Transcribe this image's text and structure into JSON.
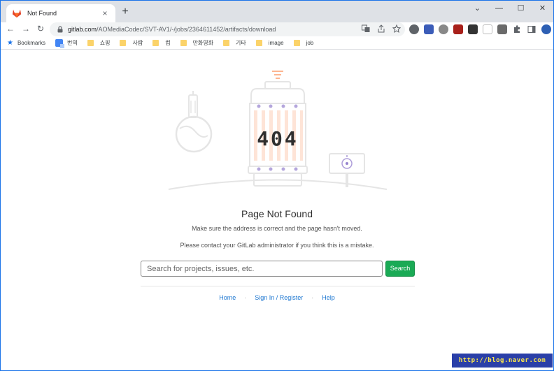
{
  "browser": {
    "tab": {
      "title": "Not Found",
      "close_glyph": "×"
    },
    "new_tab_glyph": "+",
    "window_controls": {
      "chevron": "⌄",
      "minimize": "—",
      "maximize": "☐",
      "close": "✕"
    },
    "nav": {
      "back": "←",
      "forward": "→",
      "reload": "↻"
    },
    "url": {
      "host": "gitlab.com",
      "path": "/AOMediaCodec/SVT-AV1/-/jobs/2364611452/artifacts/download"
    },
    "menu_glyph": "⋮",
    "bookmarks": [
      {
        "label": "Bookmarks",
        "icon": "star-icon"
      },
      {
        "label": "번역",
        "icon": "translate-icon"
      },
      {
        "label": "쇼핑",
        "icon": "folder-icon"
      },
      {
        "label": "사람",
        "icon": "folder-icon"
      },
      {
        "label": "컴",
        "icon": "folder-icon"
      },
      {
        "label": "만화영화",
        "icon": "folder-icon"
      },
      {
        "label": "기타",
        "icon": "folder-icon"
      },
      {
        "label": "image",
        "icon": "folder-icon"
      },
      {
        "label": "job",
        "icon": "folder-icon"
      }
    ]
  },
  "page": {
    "error_code": "404",
    "title": "Page Not Found",
    "message": "Make sure the address is correct and the page hasn't moved.",
    "contact": "Please contact your GitLab administrator if you think this is a mistake.",
    "search": {
      "placeholder": "Search for projects, issues, etc.",
      "value": "",
      "button": "Search"
    },
    "links": {
      "home": "Home",
      "signin": "Sign In / Register",
      "help": "Help",
      "separator": "·"
    }
  },
  "watermark": "http://blog.naver.com",
  "colors": {
    "accent": "#1aaa55",
    "link": "#1f78d1",
    "illustration": "#e5e5e5",
    "orange": "#fc6d26",
    "purple": "#6b4fbb"
  }
}
